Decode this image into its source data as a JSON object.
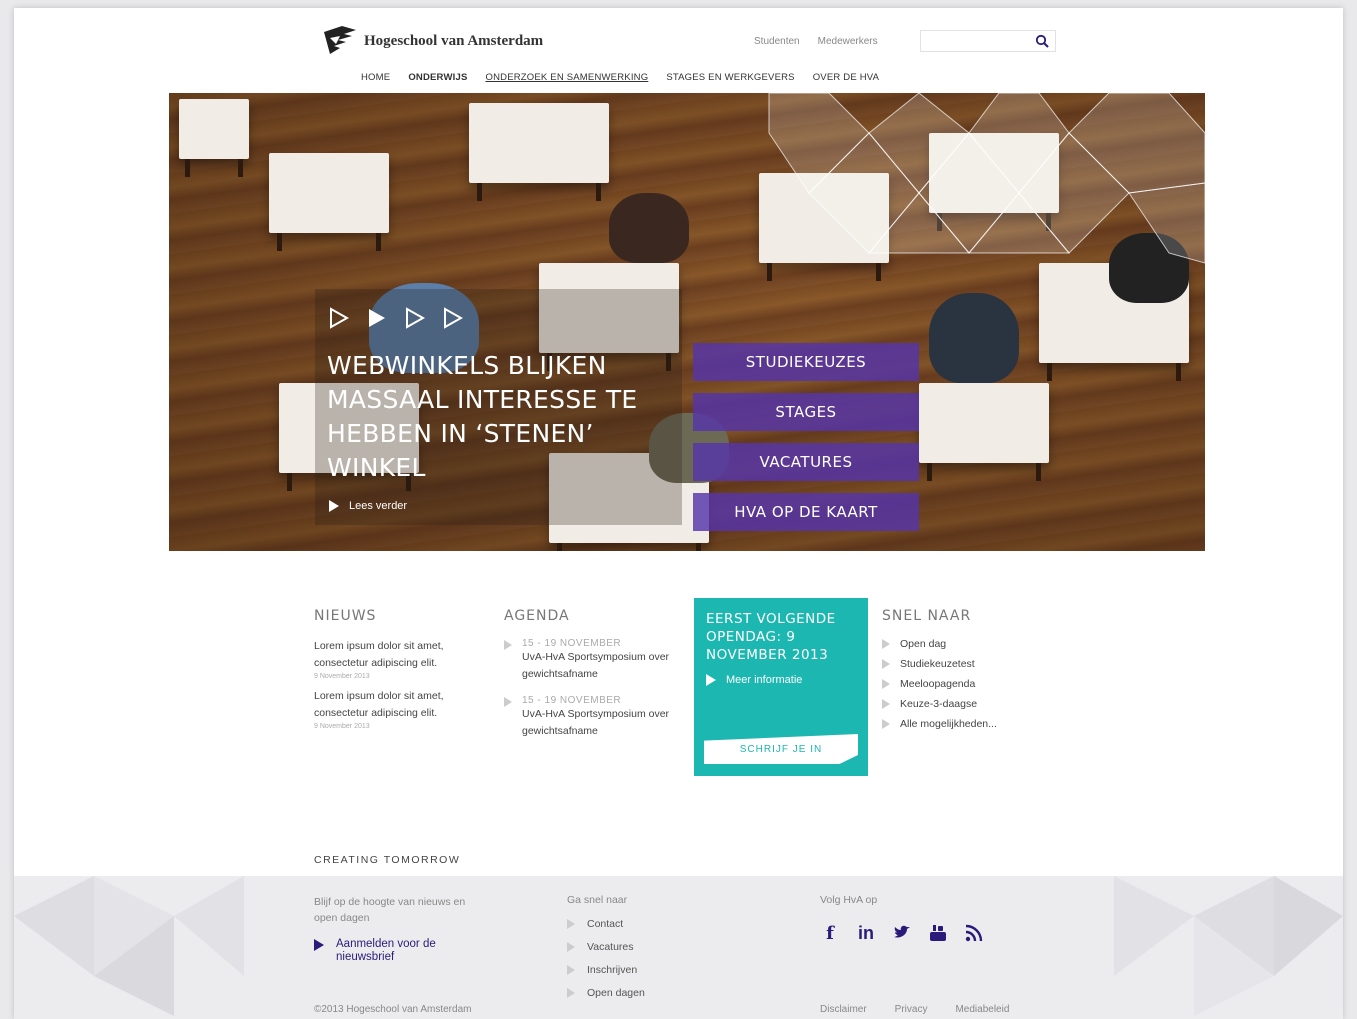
{
  "header": {
    "logo_text": "Hogeschool van Amsterdam",
    "top_links": [
      "Studenten",
      "Medewerkers"
    ],
    "search_placeholder": "",
    "nav": [
      {
        "label": "HOME"
      },
      {
        "label": "ONDERWIJS"
      },
      {
        "label": "ONDERZOEK EN SAMENWERKING"
      },
      {
        "label": "STAGES EN WERKGEVERS"
      },
      {
        "label": "OVER DE HVA"
      }
    ]
  },
  "hero": {
    "headline": "WEBWINKELS BLIJKEN MASSAAL INTERESSE TE HEBBEN IN ‘STENEN’ WINKEL",
    "read_more": "Lees verder",
    "buttons": [
      "STUDIEKEUZES",
      "STAGES",
      "VACATURES",
      "HVA OP DE KAART"
    ],
    "accent": "#5634aa"
  },
  "nieuws": {
    "title": "NIEUWS",
    "items": [
      {
        "text": "Lorem ipsum dolor sit amet, consectetur adipiscing elit.",
        "date": "9 November 2013"
      },
      {
        "text": "Lorem ipsum dolor sit amet, consectetur adipiscing elit.",
        "date": "9 November 2013"
      }
    ]
  },
  "agenda": {
    "title": "AGENDA",
    "items": [
      {
        "date": "15 - 19 NOVEMBER",
        "text": "UvA-HvA Sportsymposium over gewichtsafname"
      },
      {
        "date": "15 - 19 NOVEMBER",
        "text": "UvA-HvA Sportsymposium over gewichtsafname"
      }
    ]
  },
  "openday": {
    "heading": "EERST VOLGENDE OPENDAG: 9 NOVEMBER 2013",
    "more": "Meer informatie",
    "cta": "SCHRIJF JE IN",
    "color": "#1db7b1"
  },
  "snel": {
    "title": "SNEL NAAR",
    "items": [
      "Open dag",
      "Studiekeuzetest",
      "Meeloopagenda",
      "Keuze-3-daagse",
      "Alle mogelijkheden..."
    ]
  },
  "footer": {
    "tagline": "CREATING TOMORROW",
    "newsletter_intro": "Blijf op de hoogte van nieuws en open dagen",
    "newsletter_link": "Aanmelden voor de nieuwsbrief",
    "goto_label": "Ga snel naar",
    "goto_links": [
      "Contact",
      "Vacatures",
      "Inschrijven",
      "Open dagen"
    ],
    "follow_label": "Volg HvA op",
    "social": [
      "facebook-icon",
      "linkedin-icon",
      "twitter-icon",
      "youtube-icon",
      "rss-icon"
    ],
    "copyright": "©2013 Hogeschool van Amsterdam",
    "legal": [
      "Disclaimer",
      "Privacy",
      "Mediabeleid"
    ]
  }
}
